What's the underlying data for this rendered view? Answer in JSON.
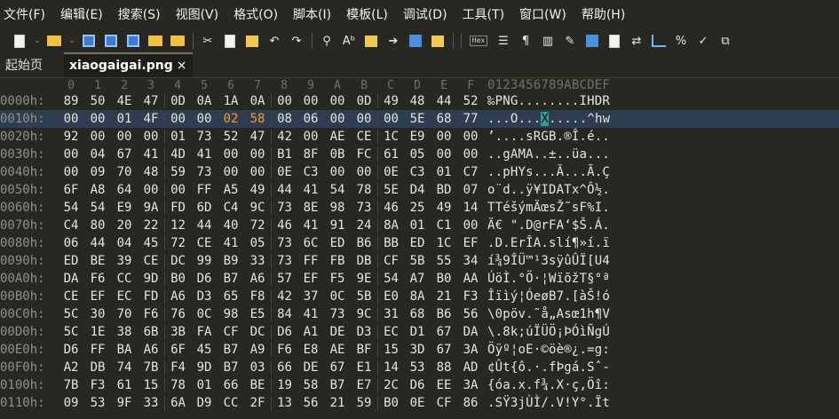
{
  "menu": [
    "文件(F)",
    "编辑(E)",
    "搜索(S)",
    "视图(V)",
    "格式(O)",
    "脚本(I)",
    "模板(L)",
    "调试(D)",
    "工具(T)",
    "窗口(W)",
    "帮助(H)"
  ],
  "toolbar_icons": [
    "new-file-icon",
    "dropdown-arrow-icon",
    "open-folder-icon",
    "dropdown-arrow-icon",
    "save-icon",
    "save-as-icon",
    "save-all-icon",
    "open-folder-2-icon",
    "open-project-icon",
    "cut-icon",
    "copy-icon",
    "paste-icon",
    "undo-icon",
    "redo-icon",
    "find-icon",
    "replace-icon",
    "find-in-files-icon",
    "goto-icon",
    "edit-as-text-icon",
    "template-icon",
    "hex-mode-icon",
    "insert-mode-icon",
    "paragraph-icon",
    "columns-icon",
    "highlight-icon",
    "calculator-icon",
    "inspector-icon",
    "swap-icon",
    "histogram-icon",
    "percent-icon",
    "checksum-icon",
    "compare-icon"
  ],
  "hex_button_label": "Hex",
  "tabs": [
    {
      "label": "起始页",
      "active": false
    },
    {
      "label": "xiaogaigai.png",
      "active": true,
      "close": "×"
    }
  ],
  "column_headers": [
    "0",
    "1",
    "2",
    "3",
    "4",
    "5",
    "6",
    "7",
    "8",
    "9",
    "A",
    "B",
    "C",
    "D",
    "E",
    "F"
  ],
  "ascii_header": "0123456789ABCDEF",
  "rows": [
    {
      "offset": "0000h:",
      "bytes": [
        "89",
        "50",
        "4E",
        "47",
        "0D",
        "0A",
        "1A",
        "0A",
        "00",
        "00",
        "00",
        "0D",
        "49",
        "48",
        "44",
        "52"
      ],
      "ascii": "‰PNG........IHDR"
    },
    {
      "offset": "0010h:",
      "bytes": [
        "00",
        "00",
        "01",
        "4F",
        "00",
        "00",
        "02",
        "58",
        "08",
        "06",
        "00",
        "00",
        "00",
        "5E",
        "68",
        "77"
      ],
      "ascii": "...O...X.....^hw",
      "highlight": true,
      "modified": [
        6,
        7
      ],
      "cursor_char": 7
    },
    {
      "offset": "0020h:",
      "bytes": [
        "92",
        "00",
        "00",
        "00",
        "01",
        "73",
        "52",
        "47",
        "42",
        "00",
        "AE",
        "CE",
        "1C",
        "E9",
        "00",
        "00"
      ],
      "ascii": "’....sRGB.®Î.é.."
    },
    {
      "offset": "0030h:",
      "bytes": [
        "00",
        "04",
        "67",
        "41",
        "4D",
        "41",
        "00",
        "00",
        "B1",
        "8F",
        "0B",
        "FC",
        "61",
        "05",
        "00",
        "00"
      ],
      "ascii": "..gAMA..±..üa..."
    },
    {
      "offset": "0040h:",
      "bytes": [
        "00",
        "09",
        "70",
        "48",
        "59",
        "73",
        "00",
        "00",
        "0E",
        "C3",
        "00",
        "00",
        "0E",
        "C3",
        "01",
        "C7"
      ],
      "ascii": "..pHYs...Ã...Ã.Ç"
    },
    {
      "offset": "0050h:",
      "bytes": [
        "6F",
        "A8",
        "64",
        "00",
        "00",
        "FF",
        "A5",
        "49",
        "44",
        "41",
        "54",
        "78",
        "5E",
        "D4",
        "BD",
        "07"
      ],
      "ascii": "o¨d..ÿ¥IDATx^Ô½."
    },
    {
      "offset": "0060h:",
      "bytes": [
        "54",
        "54",
        "E9",
        "9A",
        "FD",
        "6D",
        "C4",
        "9C",
        "73",
        "8E",
        "98",
        "73",
        "46",
        "25",
        "49",
        "14"
      ],
      "ascii": "TTéšýmÄœsŽ˜sF%I."
    },
    {
      "offset": "0070h:",
      "bytes": [
        "C4",
        "80",
        "20",
        "22",
        "12",
        "44",
        "40",
        "72",
        "46",
        "41",
        "91",
        "24",
        "8A",
        "01",
        "C1",
        "00"
      ],
      "ascii": "Ä€ \".D@rFA‘$Š.Á."
    },
    {
      "offset": "0080h:",
      "bytes": [
        "06",
        "44",
        "04",
        "45",
        "72",
        "CE",
        "41",
        "05",
        "73",
        "6C",
        "ED",
        "B6",
        "BB",
        "ED",
        "1C",
        "EF"
      ],
      "ascii": ".D.ErÎA.slí¶»í.ï"
    },
    {
      "offset": "0090h:",
      "bytes": [
        "ED",
        "BE",
        "39",
        "CE",
        "DC",
        "99",
        "B9",
        "33",
        "73",
        "FF",
        "FB",
        "DB",
        "CF",
        "5B",
        "55",
        "34"
      ],
      "ascii": "í¾9ÎÜ™¹3sÿûÛÏ[U4"
    },
    {
      "offset": "00A0h:",
      "bytes": [
        "DA",
        "F6",
        "CC",
        "9D",
        "B0",
        "D6",
        "B7",
        "A6",
        "57",
        "EF",
        "F5",
        "9E",
        "54",
        "A7",
        "B0",
        "AA"
      ],
      "ascii": "ÚöÌ.°Ö·¦WïõžT§°ª"
    },
    {
      "offset": "00B0h:",
      "bytes": [
        "CE",
        "EF",
        "EC",
        "FD",
        "A6",
        "D3",
        "65",
        "F8",
        "42",
        "37",
        "0C",
        "5B",
        "E0",
        "8A",
        "21",
        "F3"
      ],
      "ascii": "Îïìý¦ÓeøB7.[àŠ!ó"
    },
    {
      "offset": "00C0h:",
      "bytes": [
        "5C",
        "30",
        "70",
        "F6",
        "76",
        "0C",
        "98",
        "E5",
        "84",
        "41",
        "73",
        "9C",
        "31",
        "68",
        "B6",
        "56"
      ],
      "ascii": "\\0pöv.˜å„Asœ1h¶V"
    },
    {
      "offset": "00D0h:",
      "bytes": [
        "5C",
        "1E",
        "38",
        "6B",
        "3B",
        "FA",
        "CF",
        "DC",
        "D6",
        "A1",
        "DE",
        "D3",
        "EC",
        "D1",
        "67",
        "DA"
      ],
      "ascii": "\\.8k;úÏÜÖ¡ÞÓìÑgÚ"
    },
    {
      "offset": "00E0h:",
      "bytes": [
        "D6",
        "FF",
        "BA",
        "A6",
        "6F",
        "45",
        "B7",
        "A9",
        "F6",
        "E8",
        "AE",
        "BF",
        "15",
        "3D",
        "67",
        "3A"
      ],
      "ascii": "Öÿº¦oE·©öè®¿.=g:"
    },
    {
      "offset": "00F0h:",
      "bytes": [
        "A2",
        "DB",
        "74",
        "7B",
        "F4",
        "9D",
        "B7",
        "03",
        "66",
        "DE",
        "67",
        "E1",
        "14",
        "53",
        "88",
        "AD"
      ],
      "ascii": "¢Ût{ô.·.fÞgá.Sˆ-"
    },
    {
      "offset": "0100h:",
      "bytes": [
        "7B",
        "F3",
        "61",
        "15",
        "78",
        "01",
        "66",
        "BE",
        "19",
        "58",
        "B7",
        "E7",
        "2C",
        "D6",
        "EE",
        "3A"
      ],
      "ascii": "{óa.x.f¾.X·ç,Öî:"
    },
    {
      "offset": "0110h:",
      "bytes": [
        "09",
        "53",
        "9F",
        "33",
        "6A",
        "D9",
        "CC",
        "2F",
        "13",
        "56",
        "21",
        "59",
        "B0",
        "0E",
        "CF",
        "86"
      ],
      "ascii": ".SŸ3jÙÌ/.V!Y°.Ït"
    }
  ]
}
